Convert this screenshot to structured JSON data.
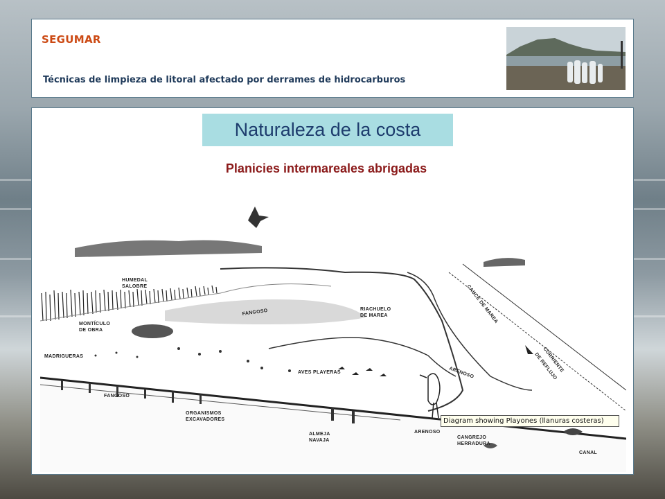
{
  "header": {
    "brand": "SEGUMAR",
    "subtitle": "Técnicas de limpieza de litoral afectado por derrames de hidrocarburos"
  },
  "slide": {
    "title": "Naturaleza de la costa",
    "section_title": "Planicies intermareales abrigadas"
  },
  "diagram": {
    "labels": {
      "humedal": "HUMEDAL",
      "salobre": "SALOBRE",
      "fangoso_top": "FANGOSO",
      "riachuelo": "RIACHUELO",
      "de_marea": "DE MAREA",
      "cauce": "CAUCE DE MAREA",
      "monticulo": "MONTÍCULO",
      "de_obra": "DE OBRA",
      "madrigueras": "MADRIGUERAS",
      "aves": "AVES PLAYERAS",
      "arenoso_mid": "ARENOSO",
      "corriente": "CORRIENTE",
      "reflujo": "DE REFLUJO",
      "fangoso_bottom": "FANGOSO",
      "organismos": "ORGANISMOS",
      "excavadores": "EXCAVADORES",
      "almeja": "ALMEJA",
      "navaja": "NAVAJA",
      "arenoso_bottom": "ARENOSO",
      "cangrejo": "CANGREJO",
      "herradura": "HERRADURA",
      "canal": "CANAL"
    },
    "tooltip": "Diagram showing Playones (llanuras costeras)"
  }
}
